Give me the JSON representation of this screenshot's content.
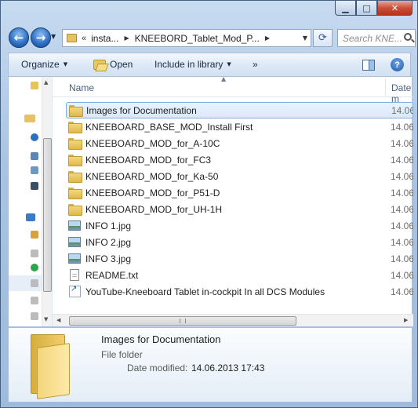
{
  "window": {
    "caption": {
      "minimize": "▁",
      "maximize": "□",
      "close": "✕"
    }
  },
  "navbar": {
    "back_glyph": "←",
    "forward_glyph": "→",
    "breadcrumb": {
      "overflow": "«",
      "segments": [
        "insta...",
        "KNEEBORD_Tablet_Mod_P..."
      ]
    },
    "search_placeholder": "Search KNE..."
  },
  "toolbar": {
    "organize": "Organize",
    "open": "Open",
    "include_in_library": "Include in library",
    "more": "»"
  },
  "columns": {
    "name": "Name",
    "date": "Date m"
  },
  "files": [
    {
      "name": "Images for Documentation",
      "type": "folder",
      "date": "14.06.",
      "selected": true
    },
    {
      "name": "KNEEBOARD_BASE_MOD_Install First",
      "type": "folder",
      "date": "14.06."
    },
    {
      "name": "KNEEBOARD_MOD_for_A-10C",
      "type": "folder",
      "date": "14.06."
    },
    {
      "name": "KNEEBOARD_MOD_for_FC3",
      "type": "folder",
      "date": "14.06."
    },
    {
      "name": "KNEEBOARD_MOD_for_Ka-50",
      "type": "folder",
      "date": "14.06."
    },
    {
      "name": "KNEEBOARD_MOD_for_P51-D",
      "type": "folder",
      "date": "14.06."
    },
    {
      "name": "KNEEBOARD_MOD_for_UH-1H",
      "type": "folder",
      "date": "14.06."
    },
    {
      "name": "INFO 1.jpg",
      "type": "image",
      "date": "14.06."
    },
    {
      "name": "INFO 2.jpg",
      "type": "image",
      "date": "14.06."
    },
    {
      "name": "INFO 3.jpg",
      "type": "image",
      "date": "14.06."
    },
    {
      "name": "README.txt",
      "type": "text",
      "date": "14.06."
    },
    {
      "name": "YouTube-Kneeboard Tablet in-cockpit In all DCS Modules",
      "type": "shortcut",
      "date": "14.06."
    }
  ],
  "details": {
    "title": "Images for Documentation",
    "type": "File folder",
    "modified_label": "Date modified:",
    "modified_value": "14.06.2013 17:43"
  }
}
